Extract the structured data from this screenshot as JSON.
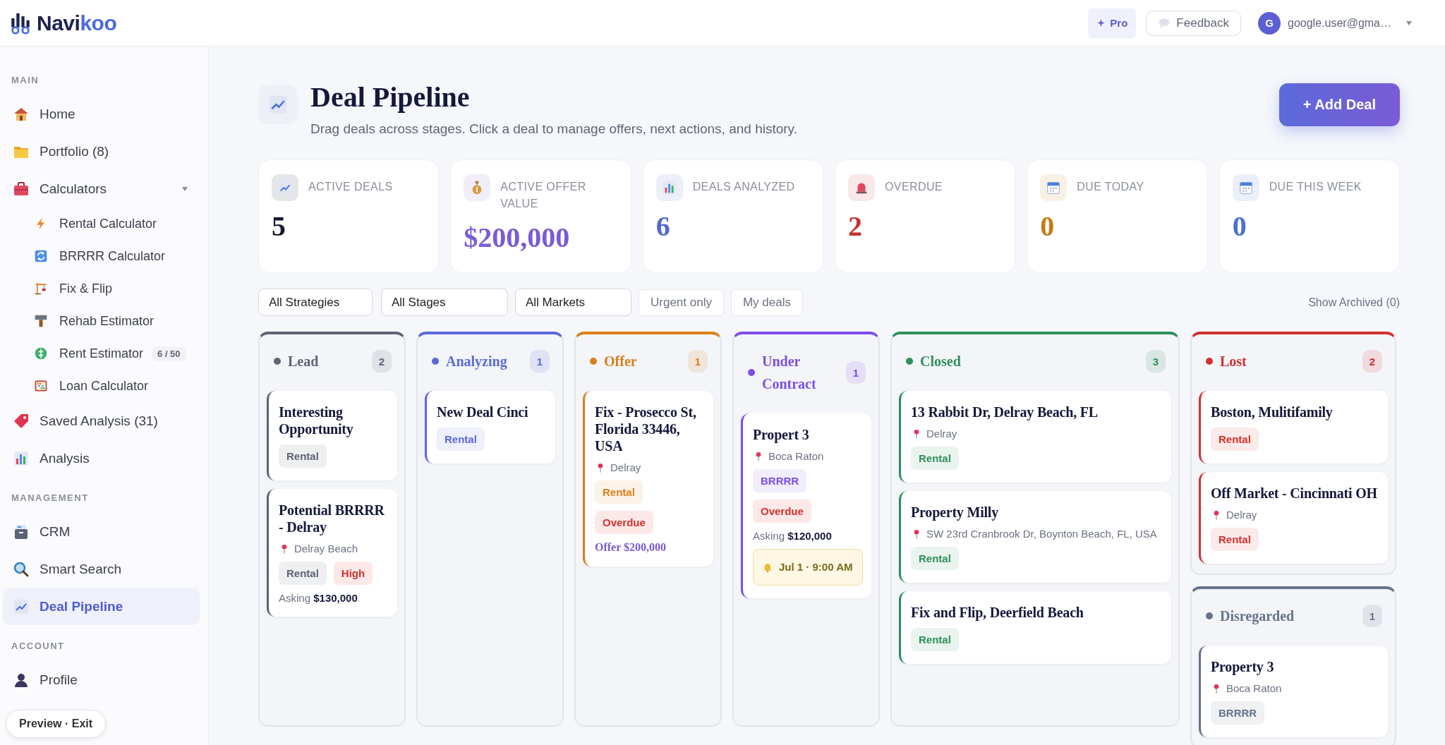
{
  "topbar": {
    "logo_main": "Navi",
    "logo_accent": "koo",
    "pro_button": "Pro",
    "feedback_button": "Feedback",
    "avatar_initial": "G",
    "account": "google.user@gma…"
  },
  "sidebar": {
    "sections": [
      {
        "heading": "MAIN",
        "items": [
          {
            "label": "Home",
            "selected": false
          },
          {
            "label": "Portfolio (8)",
            "selected": false
          },
          {
            "label": "Calculators",
            "selected": false,
            "expanded": true,
            "children": [
              {
                "label": "Rental Calculator",
                "selected": false
              },
              {
                "label": "BRRRR Calculator",
                "selected": false
              },
              {
                "label": "Fix & Flip",
                "selected": false
              },
              {
                "label": "Rehab Estimator",
                "selected": false
              },
              {
                "label": "Rent Estimator",
                "selected": false,
                "badge": "6 / 50"
              },
              {
                "label": "Loan Calculator",
                "selected": false
              }
            ]
          },
          {
            "label": "Saved Analysis (31)",
            "selected": false
          },
          {
            "label": "Analysis",
            "selected": false
          }
        ]
      },
      {
        "heading": "MANAGEMENT",
        "items": [
          {
            "label": "CRM",
            "selected": false
          },
          {
            "label": "Smart Search",
            "selected": false
          },
          {
            "label": "Deal Pipeline",
            "selected": true
          }
        ]
      },
      {
        "heading": "ACCOUNT",
        "items": [
          {
            "label": "Profile",
            "selected": false
          }
        ]
      }
    ],
    "preview_pill": "Preview · Exit"
  },
  "header": {
    "title": "Deal Pipeline",
    "subtitle": "Drag deals across stages. Click a deal to manage offers, next actions, and history.",
    "add_button": "+ Add Deal"
  },
  "stats": [
    {
      "label": "ACTIVE DEALS",
      "value": "5",
      "color": "#141833"
    },
    {
      "label": "ACTIVE OFFER VALUE",
      "value": "$200,000",
      "color": "#7b5bd6"
    },
    {
      "label": "DEALS ANALYZED",
      "value": "6",
      "color": "#5468d4"
    },
    {
      "label": "OVERDUE",
      "value": "2",
      "color": "#c53030"
    },
    {
      "label": "DUE TODAY",
      "value": "0",
      "color": "#c97a15"
    },
    {
      "label": "DUE THIS WEEK",
      "value": "0",
      "color": "#4a6fd6"
    }
  ],
  "filters": {
    "selects": [
      "All Strategies",
      "All Stages",
      "All Markets"
    ],
    "toggles": [
      {
        "label": "Urgent only",
        "on": false
      },
      {
        "label": "My deals",
        "on": false
      }
    ],
    "show_archived": "Show Archived (0)"
  },
  "lanes": [
    {
      "stages": [
        {
          "name": "Lead",
          "count": "2",
          "color": "#5d6475",
          "cards": [
            {
              "title": "Interesting Opportunity",
              "tags": [
                {
                  "label": "Rental",
                  "kind": "strategy"
                }
              ]
            },
            {
              "title": "Potential BRRRR - Delray",
              "location": "Delray Beach",
              "tags": [
                {
                  "label": "Rental",
                  "kind": "strategy"
                },
                {
                  "label": "High",
                  "kind": "alert"
                }
              ],
              "asking": "Asking **$130,000**"
            }
          ]
        }
      ]
    },
    {
      "stages": [
        {
          "name": "Analyzing",
          "count": "1",
          "color": "#5b6ad9",
          "cards": [
            {
              "title": "New Deal Cinci",
              "tags": [
                {
                  "label": "Rental",
                  "kind": "strategy"
                }
              ]
            }
          ]
        }
      ]
    },
    {
      "stages": [
        {
          "name": "Offer",
          "count": "1",
          "color": "#d97f1a",
          "cards": [
            {
              "title": "Fix - Prosecco St, Florida 33446, USA",
              "location": "Delray",
              "tags": [
                {
                  "label": "Rental",
                  "kind": "strategy"
                },
                {
                  "label": "Overdue",
                  "kind": "alert"
                }
              ],
              "offer": "Offer $200,000"
            }
          ]
        }
      ]
    },
    {
      "stages": [
        {
          "name": "Under Contract",
          "count": "1",
          "color": "#7c4dea",
          "cards": [
            {
              "title": "Propert 3",
              "location": "Boca Raton",
              "tags": [
                {
                  "label": "BRRRR",
                  "kind": "strategy"
                },
                {
                  "label": "Overdue",
                  "kind": "alert"
                }
              ],
              "asking": "Asking **$120,000**",
              "reminder": "Jul 1 · 9:00 AM"
            }
          ]
        }
      ]
    },
    {
      "stages": [
        {
          "name": "Closed",
          "count": "3",
          "color": "#2f8f5b",
          "cards": [
            {
              "title": "13 Rabbit Dr, Delray Beach, FL",
              "location": "Delray",
              "tags": [
                {
                  "label": "Rental",
                  "kind": "strategy"
                }
              ]
            },
            {
              "title": "Property Milly",
              "location": "SW 23rd Cranbrook Dr, Boynton Beach, FL, USA",
              "tags": [
                {
                  "label": "Rental",
                  "kind": "strategy"
                }
              ]
            },
            {
              "title": "Fix and Flip, Deerfield Beach",
              "tags": [
                {
                  "label": "Rental",
                  "kind": "strategy"
                }
              ]
            }
          ]
        }
      ]
    },
    {
      "stages": [
        {
          "name": "Lost",
          "count": "2",
          "color": "#d0312d",
          "cards": [
            {
              "title": "Boston, Mulitifamily",
              "tags": [
                {
                  "label": "Rental",
                  "kind": "strategy"
                }
              ]
            },
            {
              "title": "Off Market - Cincinnati OH",
              "location": "Delray",
              "tags": [
                {
                  "label": "Rental",
                  "kind": "strategy"
                }
              ]
            }
          ]
        },
        {
          "name": "Disregarded",
          "count": "1",
          "color": "#64748b",
          "cards": [
            {
              "title": "Property 3",
              "location": "Boca Raton",
              "tags": [
                {
                  "label": "BRRRR",
                  "kind": "strategy"
                }
              ]
            }
          ]
        }
      ]
    }
  ]
}
